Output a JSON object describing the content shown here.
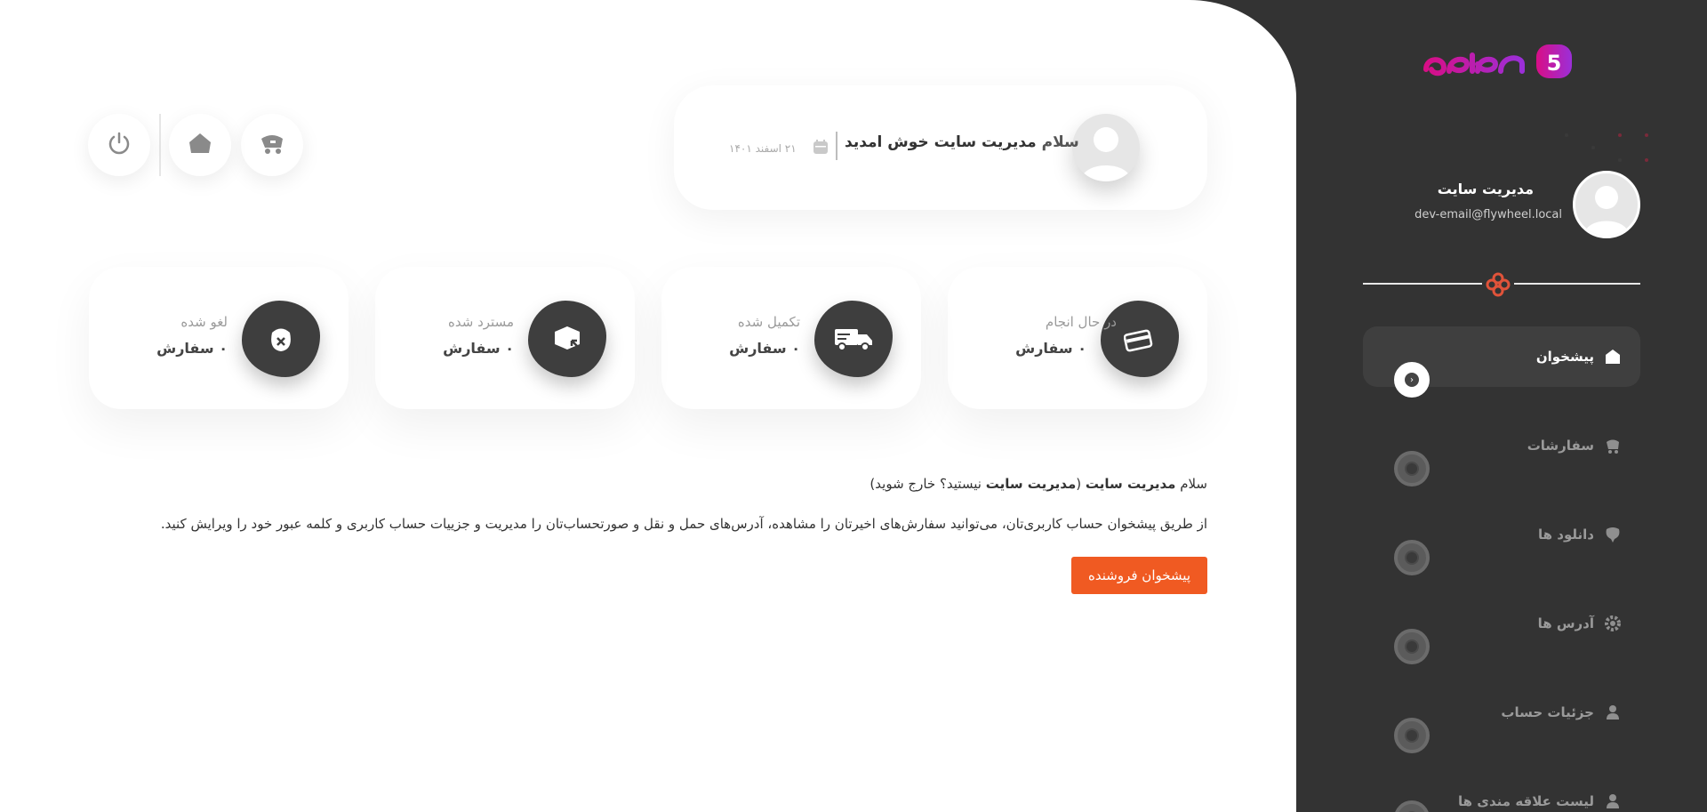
{
  "header": {
    "greeting_prefix": "سلام",
    "greeting_name": "مدیریت سایت",
    "greeting_suffix": "خوش امدید",
    "date": "۲۱ اسفند ۱۴۰۱",
    "icons": [
      "calendar-icon"
    ]
  },
  "top_actions": [
    {
      "name": "cart-button",
      "icon": "cart-icon"
    },
    {
      "name": "home-button",
      "icon": "home-icon"
    },
    {
      "name": "logout-button",
      "icon": "power-icon"
    }
  ],
  "stats": [
    {
      "title": "در حال انجام",
      "value": "۰ سفارش",
      "icon": "card-icon"
    },
    {
      "title": "تکمیل شده",
      "value": "۰ سفارش",
      "icon": "truck-icon"
    },
    {
      "title": "مسترد شده",
      "value": "۰ سفارش",
      "icon": "return-box-icon"
    },
    {
      "title": "لغو شده",
      "value": "۰ سفارش",
      "icon": "cancel-bag-icon"
    }
  ],
  "content": {
    "hello_prefix": "سلام",
    "hello_name": "مدیریت سایت",
    "hello_paren_open": " (",
    "hello_paren_name": "مدیریت سایت",
    "hello_rest": " نیستید؟ خارج شوید)",
    "description": "از طریق پیشخوان حساب کاربری‌تان، می‌توانید سفارش‌های اخیرتان را مشاهده، آدرس‌های حمل و نقل و صورتحساب‌تان را مدیریت و جزییات حساب کاربری و کلمه عبور خود را ویرایش کنید.",
    "vendor_button": "پیشخوان فروشنده"
  },
  "sidebar": {
    "profile_name": "مدیریت سایت",
    "profile_email": "dev-email@flywheel.local",
    "items": [
      {
        "label": "پیشخوان",
        "icon": "dashboard-icon",
        "active": true
      },
      {
        "label": "سفارشات",
        "icon": "orders-icon",
        "active": false
      },
      {
        "label": "دانلود ها",
        "icon": "download-icon",
        "active": false
      },
      {
        "label": "آدرس ها",
        "icon": "address-icon",
        "active": false
      },
      {
        "label": "جزئیات حساب",
        "icon": "user-icon",
        "active": false
      },
      {
        "label": "لیست علاقه مندی ها",
        "icon": "wishlist-icon",
        "active": false
      }
    ]
  },
  "colors": {
    "sidebar_bg": "#333333",
    "accent_button": "#f05a22",
    "logo_gradient_start": "#e0137a",
    "logo_gradient_end": "#8a2be2"
  }
}
